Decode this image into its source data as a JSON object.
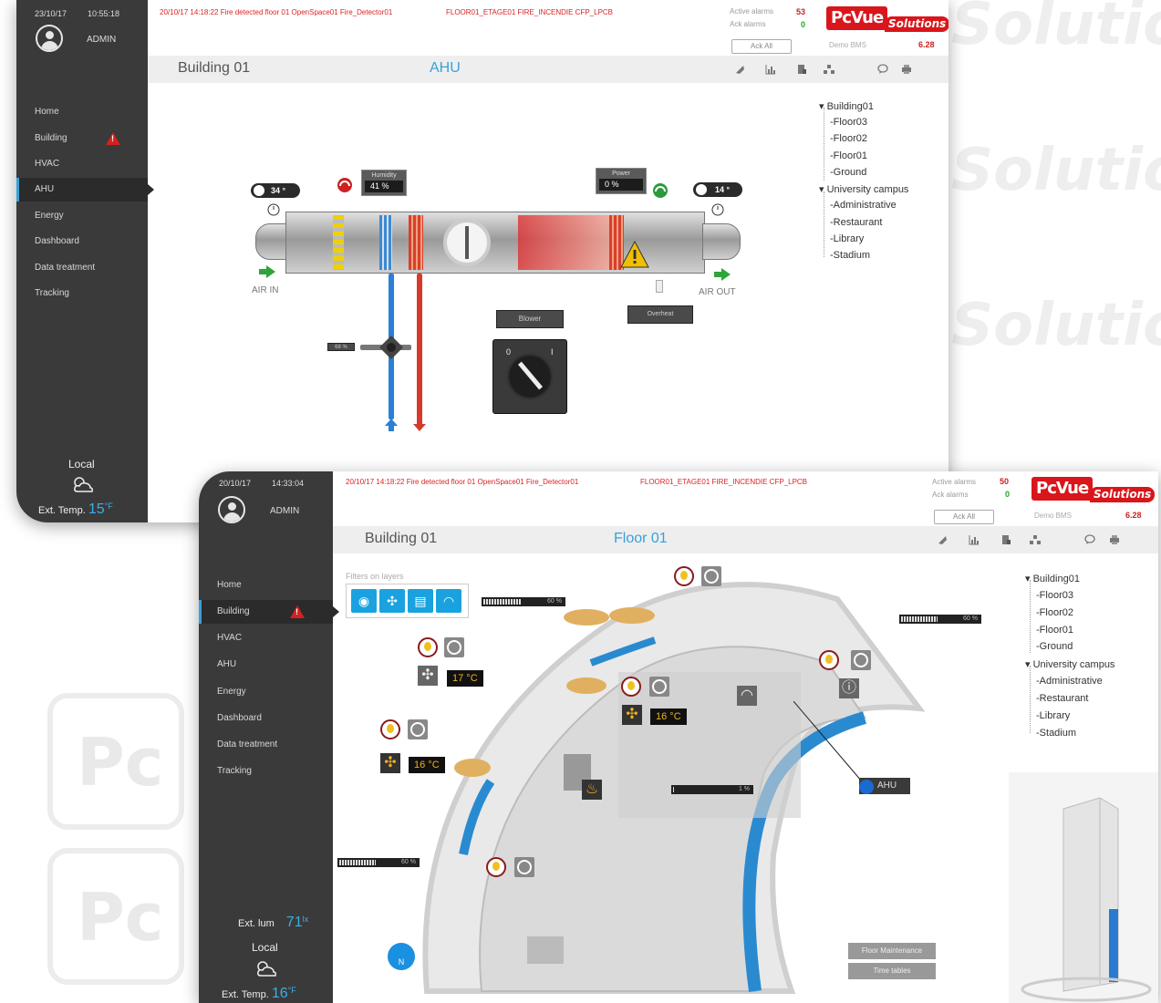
{
  "w1": {
    "date": "23/10/17",
    "time": "10:55:18",
    "user": "ADMIN",
    "nav": [
      {
        "label": "Home"
      },
      {
        "label": "Building"
      },
      {
        "label": "HVAC"
      },
      {
        "label": "AHU"
      },
      {
        "label": "Energy"
      },
      {
        "label": "Dashboard"
      },
      {
        "label": "Data treatment"
      },
      {
        "label": "Tracking"
      }
    ],
    "local": "Local",
    "ext_temp_label": "Ext. Temp.",
    "ext_temp_value": "15",
    "ext_temp_unit": "°F",
    "alarm_text": "20/10/17  14:18:22  Fire detected floor 01 OpenSpace01 Fire_Detector01",
    "alarm_code": "FLOOR01_ETAGE01   FIRE_INCENDIE   CFP_LPCB",
    "active_alarms_label": "Active alarms",
    "active_alarms": "53",
    "ack_alarms_label": "Ack alarms",
    "ack_alarms": "0",
    "ack_all": "Ack All",
    "demo": "Demo BMS",
    "version": "6.28",
    "title": "Building 01",
    "page": "AHU",
    "tree": [
      "Building01",
      "Floor03",
      "Floor02",
      "Floor01",
      "Ground",
      "University campus",
      "Administrative",
      "Restaurant",
      "Library",
      "Stadium"
    ],
    "ahu": {
      "temp_in": "34 °",
      "temp_out": "14 °",
      "humidity_label": "Humidity",
      "humidity_value": "41  %",
      "power_label": "Power",
      "power_value": "0      %",
      "air_in": "AIR IN",
      "air_out": "AIR OUT",
      "blower": "Blower",
      "overheat": "Overheat",
      "switch_0": "0",
      "switch_1": "I",
      "valve_pct": "68 %"
    }
  },
  "w2": {
    "date": "20/10/17",
    "time": "14:33:04",
    "user": "ADMIN",
    "nav": [
      {
        "label": "Home"
      },
      {
        "label": "Building"
      },
      {
        "label": "HVAC"
      },
      {
        "label": "AHU"
      },
      {
        "label": "Energy"
      },
      {
        "label": "Dashboard"
      },
      {
        "label": "Data treatment"
      },
      {
        "label": "Tracking"
      }
    ],
    "ext_lum_label": "Ext. lum",
    "ext_lum_value": "71",
    "ext_lum_unit": "lx",
    "local": "Local",
    "ext_temp_label": "Ext. Temp.",
    "ext_temp_value": "16",
    "ext_temp_unit": "°F",
    "alarm_text": "20/10/17  14:18:22  Fire detected floor 01 OpenSpace01 Fire_Detector01",
    "alarm_code": "FLOOR01_ETAGE01   FIRE_INCENDIE   CFP_LPCB",
    "active_alarms_label": "Active alarms",
    "active_alarms": "50",
    "ack_alarms_label": "Ack alarms",
    "ack_alarms": "0",
    "ack_all": "Ack All",
    "demo": "Demo BMS",
    "version": "6.28",
    "title": "Building 01",
    "page": "Floor 01",
    "filters_label": "Filters on layers",
    "tree": [
      "Building01",
      "Floor03",
      "Floor02",
      "Floor01",
      "Ground",
      "University campus",
      "Administrative",
      "Restaurant",
      "Library",
      "Stadium"
    ],
    "floor": {
      "bar1": "60 %",
      "bar2": "60 %",
      "bar3": "1 %",
      "bar4": "60 %",
      "temp1": "17 °C",
      "temp2": "16 °C",
      "temp3": "16 °C",
      "ahu": "AHU",
      "compass": "N",
      "floor_maintenance": "Floor Maintenance",
      "time_tables": "Time tables"
    }
  },
  "brand": {
    "pc": "PcVue",
    "sol": "Solutions",
    "bg_word": "Solutions",
    "tile": "Pc"
  }
}
